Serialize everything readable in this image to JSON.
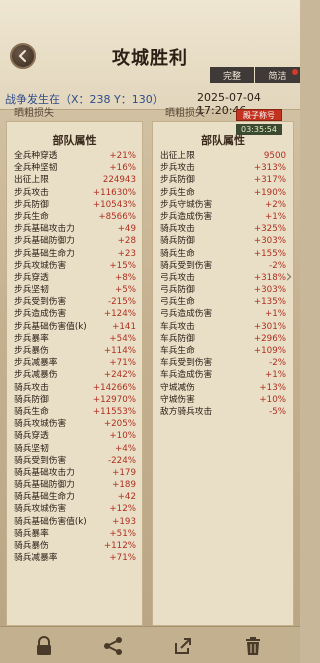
{
  "header": {
    "title": "攻城胜利",
    "tabs": {
      "complete": "完整",
      "simple": "简洁"
    },
    "war_label": "战争发生在（X：238 Y：130）",
    "date": "2025-07-04  17:20:46"
  },
  "peek": {
    "left": "晒粗损失",
    "right": "晒粗损失"
  },
  "badge": {
    "label": "殿子称号",
    "timer": "03:35:54"
  },
  "left_panel": {
    "title": "部队属性",
    "rows": [
      {
        "name": "全兵种穿透",
        "value": "+21%"
      },
      {
        "name": "全兵种坚韧",
        "value": "+16%"
      },
      {
        "name": "出征上限",
        "value": "224943"
      },
      {
        "name": "步兵攻击",
        "value": "+11630%"
      },
      {
        "name": "步兵防御",
        "value": "+10543%"
      },
      {
        "name": "步兵生命",
        "value": "+8566%"
      },
      {
        "name": "步兵基础攻击力",
        "value": "+49"
      },
      {
        "name": "步兵基础防御力",
        "value": "+28"
      },
      {
        "name": "步兵基础生命力",
        "value": "+23"
      },
      {
        "name": "步兵攻城伤害",
        "value": "+15%"
      },
      {
        "name": "步兵穿透",
        "value": "+8%"
      },
      {
        "name": "步兵坚韧",
        "value": "+5%"
      },
      {
        "name": "步兵受到伤害",
        "value": "-215%"
      },
      {
        "name": "步兵造成伤害",
        "value": "+124%"
      },
      {
        "name": "步兵基础伤害值(k)",
        "value": "+141"
      },
      {
        "name": "步兵暴率",
        "value": "+54%"
      },
      {
        "name": "步兵暴伤",
        "value": "+114%"
      },
      {
        "name": "步兵减暴率",
        "value": "+71%"
      },
      {
        "name": "步兵减暴伤",
        "value": "+242%"
      },
      {
        "name": "骑兵攻击",
        "value": "+14266%"
      },
      {
        "name": "骑兵防御",
        "value": "+12970%"
      },
      {
        "name": "骑兵生命",
        "value": "+11553%"
      },
      {
        "name": "骑兵攻城伤害",
        "value": "+205%"
      },
      {
        "name": "骑兵穿透",
        "value": "+10%"
      },
      {
        "name": "骑兵坚韧",
        "value": "+4%"
      },
      {
        "name": "骑兵受到伤害",
        "value": "-224%"
      },
      {
        "name": "骑兵基础攻击力",
        "value": "+179"
      },
      {
        "name": "骑兵基础防御力",
        "value": "+189"
      },
      {
        "name": "骑兵基础生命力",
        "value": "+42"
      },
      {
        "name": "骑兵攻城伤害",
        "value": "+12%"
      },
      {
        "name": "骑兵基础伤害值(k)",
        "value": "+193"
      },
      {
        "name": "骑兵暴率",
        "value": "+51%"
      },
      {
        "name": "骑兵暴伤",
        "value": "+112%"
      },
      {
        "name": "骑兵减暴率",
        "value": "+71%"
      }
    ]
  },
  "right_panel": {
    "title": "部队属性",
    "rows": [
      {
        "name": "出征上限",
        "value": "9500"
      },
      {
        "name": "步兵攻击",
        "value": "+313%"
      },
      {
        "name": "步兵防御",
        "value": "+317%"
      },
      {
        "name": "步兵生命",
        "value": "+190%"
      },
      {
        "name": "步兵守城伤害",
        "value": "+2%"
      },
      {
        "name": "步兵造成伤害",
        "value": "+1%"
      },
      {
        "name": "骑兵攻击",
        "value": "+325%"
      },
      {
        "name": "骑兵防御",
        "value": "+303%"
      },
      {
        "name": "骑兵生命",
        "value": "+155%"
      },
      {
        "name": "骑兵受到伤害",
        "value": "-2%"
      },
      {
        "name": "弓兵攻击",
        "value": "+318%"
      },
      {
        "name": "弓兵防御",
        "value": "+303%"
      },
      {
        "name": "弓兵生命",
        "value": "+135%"
      },
      {
        "name": "弓兵造成伤害",
        "value": "+1%"
      },
      {
        "name": "车兵攻击",
        "value": "+301%"
      },
      {
        "name": "车兵防御",
        "value": "+296%"
      },
      {
        "name": "车兵生命",
        "value": "+109%"
      },
      {
        "name": "车兵受到伤害",
        "value": "-2%"
      },
      {
        "name": "车兵造成伤害",
        "value": "+1%"
      },
      {
        "name": "守城减伤",
        "value": "+13%"
      },
      {
        "name": "守城伤害",
        "value": "+10%"
      },
      {
        "name": "敌方骑兵攻击",
        "value": "-5%"
      }
    ]
  },
  "toolbar": {
    "icons": [
      "lock-icon",
      "share-icon",
      "export-icon",
      "trash-icon"
    ]
  }
}
